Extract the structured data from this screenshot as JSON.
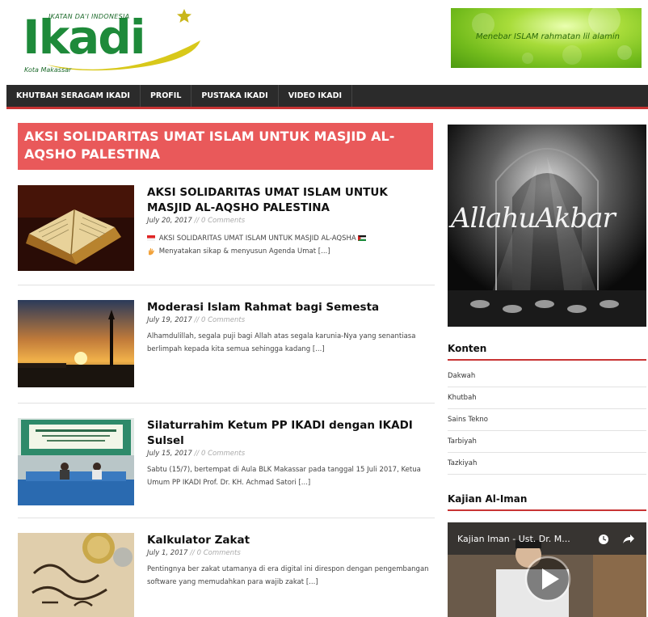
{
  "header": {
    "logo_tagline": "IKATAN DA'I INDONESIA",
    "logo_word": "Ikadi",
    "logo_city": "Kota Makassar",
    "banner_text": "Menebar ISLAM rahmatan lil alamin"
  },
  "nav": {
    "items": [
      "KHUTBAH SERAGAM IKADI",
      "PROFIL",
      "PUSTAKA IKADI",
      "VIDEO IKADI"
    ]
  },
  "archive": {
    "title": "AKSI SOLIDARITAS UMAT ISLAM UNTUK MASJID AL-AQSHO PALESTINA"
  },
  "posts": [
    {
      "title": "AKSI SOLIDARITAS UMAT ISLAM UNTUK MASJID AL-AQSHO PALESTINA",
      "date": "July 20, 2017",
      "comments": "0 Comments",
      "excerpt": "AKSI SOLIDARITAS UMAT ISLAM UNTUK MASJID AL-AQSHA",
      "excerpt_line2": "Menyatakan sikap & menyusun Agenda Umat [...]"
    },
    {
      "title": "Moderasi Islam Rahmat bagi Semesta",
      "date": "July 19, 2017",
      "comments": "0 Comments",
      "excerpt": "Alhamdulillah, segala puji bagi Allah atas segala karunia-Nya yang senantiasa berlimpah kepada kita semua sehingga kadang [...]"
    },
    {
      "title": "Silaturrahim Ketum PP IKADI dengan IKADI Sulsel",
      "date": "July 15, 2017",
      "comments": "0 Comments",
      "excerpt": "Sabtu (15/7), bertempat di Aula BLK Makassar pada tanggal 15 Juli 2017, Ketua Umum PP IKADI Prof. Dr. KH. Achmad Satori [...]"
    },
    {
      "title": "Kalkulator Zakat",
      "date": "July 1, 2017",
      "comments": "0 Comments",
      "excerpt": "Pentingnya ber zakat utamanya di era digital ini direspon dengan pengembangan software yang memudahkan para wajib zakat [...]"
    }
  ],
  "meta_separator": "//",
  "sidebar": {
    "image_caption": "AllahuAkbar",
    "konten_title": "Konten",
    "categories": [
      "Dakwah",
      "Khutbah",
      "Sains Tekno",
      "Tarbiyah",
      "Tazkiyah"
    ],
    "kajian_title": "Kajian Al-Iman",
    "video_title": "Kajian Iman - Ust. Dr. M..."
  },
  "colors": {
    "brand_green": "#1e8a3a",
    "accent_red": "#c83434",
    "archive_bg": "#e9595a",
    "nav_bg": "#2b2b2b"
  },
  "icons": {
    "play": "play-icon",
    "clock": "clock-icon",
    "share": "share-icon",
    "flag_id": "indonesia-flag-icon",
    "flag_ps": "palestine-flag-icon",
    "hand": "raised-hand-icon"
  }
}
